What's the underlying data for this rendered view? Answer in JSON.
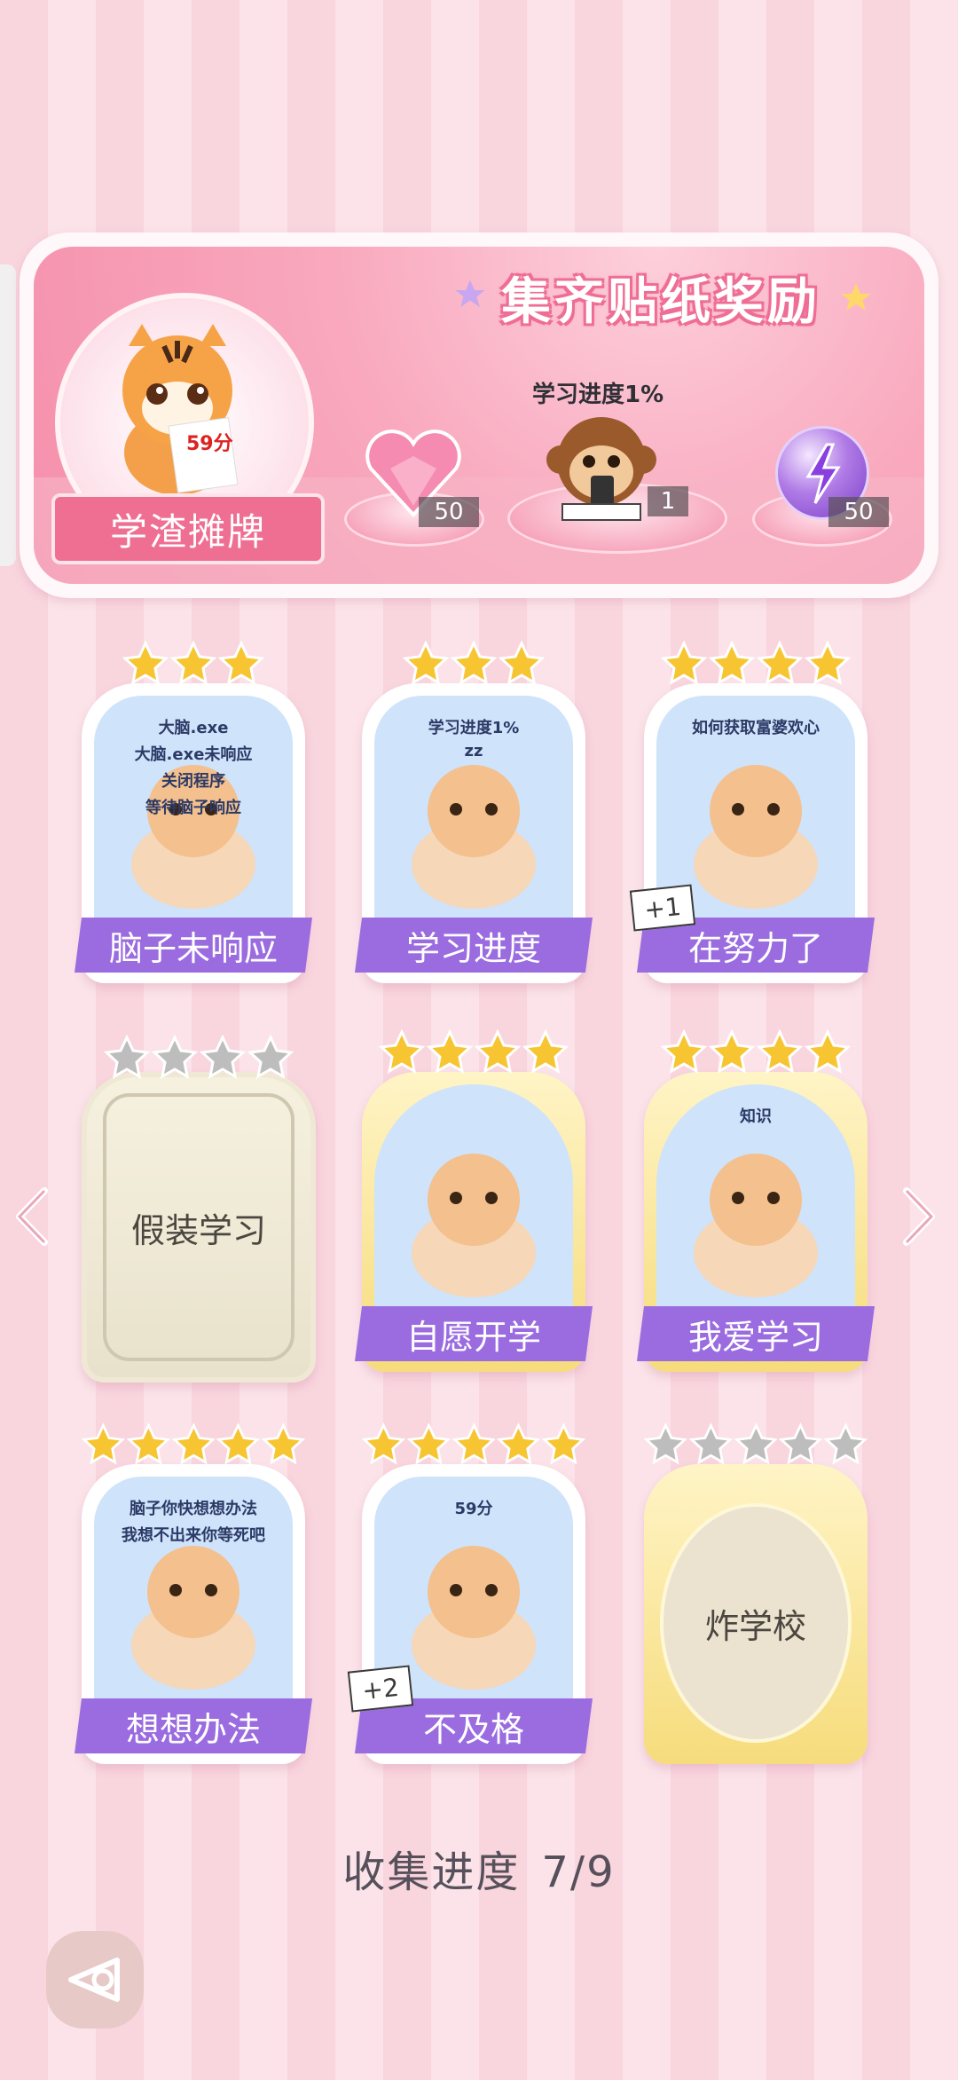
{
  "banner": {
    "title": "集齐贴纸奖励",
    "study_progress": "学习进度1%",
    "avatar_label": "学渣摊牌",
    "avatar_note": "59分",
    "rewards": [
      {
        "icon": "heart-gem-icon",
        "count": "50"
      },
      {
        "icon": "monkey-sticker-icon",
        "count": "1"
      },
      {
        "icon": "lightning-orb-icon",
        "count": "50"
      }
    ]
  },
  "cards": [
    {
      "label": "脑子未响应",
      "stars": 3,
      "lit": 3,
      "locked": false,
      "tag": "",
      "art_text": [
        "大脑.exe",
        "大脑.exe未响应",
        "关闭程序",
        "等待脑子响应"
      ]
    },
    {
      "label": "学习进度",
      "stars": 3,
      "lit": 3,
      "locked": false,
      "tag": "",
      "art_text": [
        "学习进度1%",
        "zz"
      ]
    },
    {
      "label": "在努力了",
      "stars": 4,
      "lit": 4,
      "locked": false,
      "tag": "+1",
      "art_text": [
        "如何获取富婆欢心"
      ]
    },
    {
      "label": "假装学习",
      "stars": 4,
      "lit": 0,
      "locked": true,
      "tag": "",
      "art_text": []
    },
    {
      "label": "自愿开学",
      "stars": 4,
      "lit": 4,
      "locked": false,
      "tag": "",
      "art_text": []
    },
    {
      "label": "我爱学习",
      "stars": 4,
      "lit": 4,
      "locked": false,
      "tag": "",
      "art_text": [
        "知识"
      ]
    },
    {
      "label": "想想办法",
      "stars": 5,
      "lit": 5,
      "locked": false,
      "tag": "",
      "art_text": [
        "脑子你快想想办法",
        "我想不出来你等死吧"
      ]
    },
    {
      "label": "不及格",
      "stars": 5,
      "lit": 5,
      "locked": false,
      "tag": "+2",
      "art_text": [
        "59分"
      ]
    },
    {
      "label": "炸学校",
      "stars": 5,
      "lit": 0,
      "locked": true,
      "tag": "",
      "art_text": []
    }
  ],
  "collection": {
    "label": "收集进度",
    "value": "7/9"
  },
  "colors": {
    "accent": "#9a6ce0",
    "pink": "#ef6f93",
    "gold_star": "#f7c531",
    "grey_star": "#bdbdbd"
  }
}
